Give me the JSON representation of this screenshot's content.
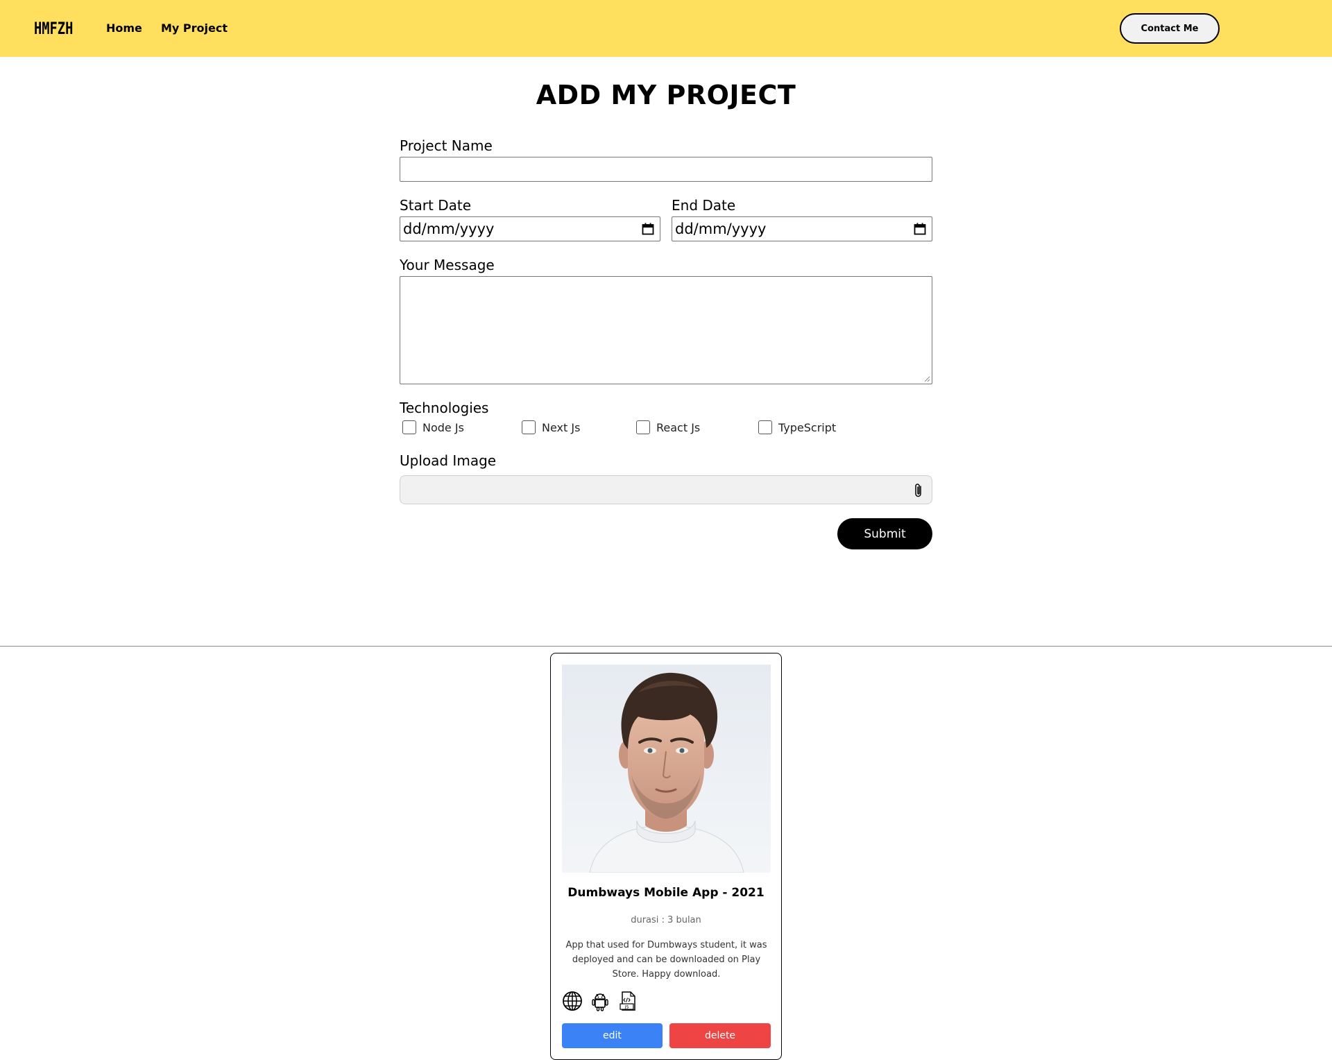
{
  "navbar": {
    "logo": "HMFZH",
    "links": [
      {
        "label": "Home"
      },
      {
        "label": "My Project"
      }
    ],
    "contact_label": "Contact Me"
  },
  "form": {
    "title": "ADD MY PROJECT",
    "project_name_label": "Project Name",
    "project_name_value": "",
    "start_date_label": "Start Date",
    "start_date_placeholder": "dd/mm/yyyy",
    "end_date_label": "End Date",
    "end_date_placeholder": "dd/mm/yyyy",
    "message_label": "Your Message",
    "message_value": "",
    "technologies_label": "Technologies",
    "technologies": [
      {
        "label": "Node Js",
        "checked": false
      },
      {
        "label": "Next Js",
        "checked": false
      },
      {
        "label": "React Js",
        "checked": false
      },
      {
        "label": "TypeScript",
        "checked": false
      }
    ],
    "upload_label": "Upload Image",
    "submit_label": "Submit"
  },
  "card": {
    "title": "Dumbways Mobile App - 2021",
    "duration": "durasi : 3 bulan",
    "description": "App that used for Dumbways student, it was deployed and can be downloaded on Play Store. Happy download.",
    "tech_icons": [
      "globe-icon",
      "android-icon",
      "javascript-file-icon"
    ],
    "edit_label": "edit",
    "delete_label": "delete"
  }
}
